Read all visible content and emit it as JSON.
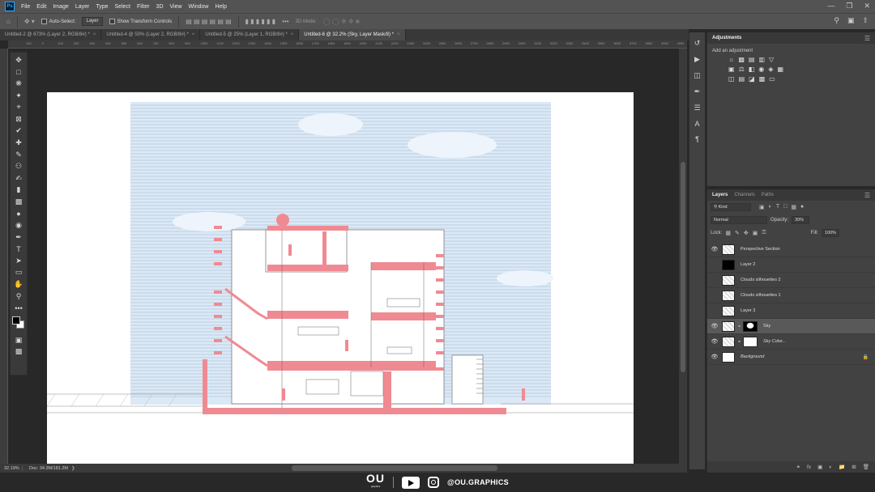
{
  "menu": {
    "app_icon": "Ps",
    "items": [
      "File",
      "Edit",
      "Image",
      "Layer",
      "Type",
      "Select",
      "Filter",
      "3D",
      "View",
      "Window",
      "Help"
    ]
  },
  "options": {
    "auto_select_label": "Auto-Select:",
    "auto_select_value": "Layer",
    "show_transform_label": "Show Transform Controls",
    "mode_3d_label": "3D Mode:"
  },
  "tabs": [
    {
      "label": "Untitled-2 @ 673% (Layer 2, RGB/8#) *",
      "active": false
    },
    {
      "label": "Untitled-4 @ 50% (Layer 2, RGB/8#) *",
      "active": false
    },
    {
      "label": "Untitled-5 @ 25% (Layer 1, RGB/8#) *",
      "active": false
    },
    {
      "label": "Untitled-6 @ 32.2% (Sky, Layer Mask/8) *",
      "active": true
    }
  ],
  "ruler_ticks": [
    "100",
    "0",
    "100",
    "200",
    "300",
    "400",
    "500",
    "600",
    "700",
    "800",
    "900",
    "1000",
    "1100",
    "1200",
    "1300",
    "1400",
    "1500",
    "1600",
    "1700",
    "1800",
    "1900",
    "2000",
    "2100",
    "2200",
    "2300",
    "2400",
    "2500",
    "2600",
    "2700",
    "2800",
    "2900",
    "3000",
    "3100",
    "3200",
    "3300",
    "3400",
    "3500",
    "3600",
    "3700",
    "3800",
    "3900",
    "4000",
    "4100",
    "4200"
  ],
  "status": {
    "zoom": "32.19%",
    "doc": "Doc: 34.3M/181.2M"
  },
  "adjustments": {
    "title": "Adjustments",
    "add_label": "Add an adjustment"
  },
  "layers_panel": {
    "tabs": [
      "Layers",
      "Channels",
      "Paths"
    ],
    "kind": "Kind",
    "blend_mode": "Normal",
    "opacity_label": "Opacity:",
    "opacity": "30%",
    "lock_label": "Lock:",
    "fill_label": "Fill:",
    "fill": "100%",
    "layers": [
      {
        "name": "Perspective Section",
        "visible": true,
        "thumb": "checker",
        "selected": false,
        "italic": false
      },
      {
        "name": "Layer 2",
        "visible": false,
        "thumb": "black",
        "selected": false,
        "italic": false
      },
      {
        "name": "Clouds silhouettes 2",
        "visible": false,
        "thumb": "checker",
        "selected": false,
        "italic": false
      },
      {
        "name": "Clouds silhouettes 1",
        "visible": false,
        "thumb": "checker",
        "selected": false,
        "italic": false
      },
      {
        "name": "Layer 3",
        "visible": false,
        "thumb": "checker",
        "selected": false,
        "italic": false
      },
      {
        "name": "Sky",
        "visible": true,
        "thumb": "checker",
        "selected": true,
        "italic": false,
        "mask": true
      },
      {
        "name": "Sky Color...",
        "visible": true,
        "thumb": "checker",
        "selected": false,
        "italic": true,
        "mask_white": true
      },
      {
        "name": "Background",
        "visible": true,
        "thumb": "white",
        "selected": false,
        "italic": true,
        "locked": true
      }
    ]
  },
  "brand": {
    "logo": "OU",
    "logo_sub": "graphics",
    "handle": "@OU.GRAPHICS"
  },
  "colors": {
    "sky": "#dbe9f6",
    "section_pink": "#f08a92",
    "ui_dark": "#282828",
    "ui_panel": "#424242"
  }
}
